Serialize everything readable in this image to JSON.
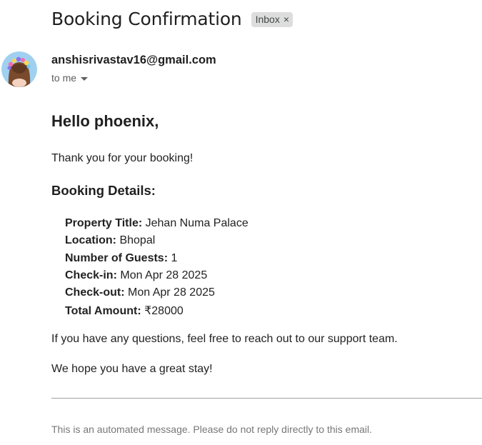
{
  "email": {
    "subject": "Booking Confirmation",
    "label": "Inbox",
    "label_remove": "×",
    "sender": "anshisrivastav16@gmail.com",
    "recipient": "to me"
  },
  "content": {
    "greeting": "Hello phoenix,",
    "thanks": "Thank you for your booking!",
    "details_heading": "Booking Details:",
    "details": [
      {
        "key": "Property Title:",
        "value": "Jehan Numa Palace"
      },
      {
        "key": "Location:",
        "value": "Bhopal"
      },
      {
        "key": "Number of Guests:",
        "value": "1"
      },
      {
        "key": "Check-in:",
        "value": "Mon Apr 28 2025"
      },
      {
        "key": "Check-out:",
        "value": "Mon Apr 28 2025"
      },
      {
        "key": "Total Amount:",
        "value": "₹28000"
      }
    ],
    "questions": "If you have any questions, feel free to reach out to our support team.",
    "closing": "We hope you have a great stay!",
    "footer": "This is an automated message. Please do not reply directly to this email."
  },
  "colors": {
    "avatar_bg": "#9fd0f0",
    "label_bg": "#dddddd"
  }
}
